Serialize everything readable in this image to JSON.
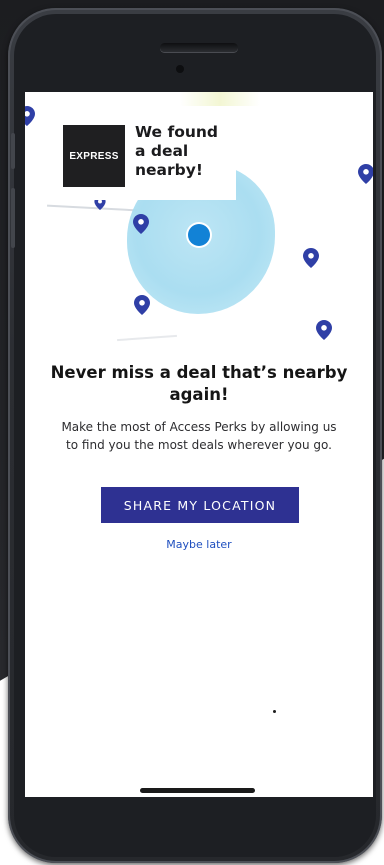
{
  "callout": {
    "brand": "EXPRESS",
    "message_lines": [
      "We found",
      "a deal",
      "nearby!"
    ]
  },
  "headline_lines": [
    "Never miss a deal that’s nearby",
    "again!"
  ],
  "subtext_lines": [
    "Make the most of Access Perks by allowing us",
    "to find you the most deals wherever you go."
  ],
  "actions": {
    "share_location_label": "SHARE MY LOCATION",
    "maybe_later_label": "Maybe later"
  },
  "map": {
    "pin_icon": "map-pin-icon",
    "user_marker_icon": "current-location-dot-icon"
  },
  "colors": {
    "primary_button": "#2e3192",
    "link": "#1f4fbf",
    "pin": "#2f3fa6",
    "location_dot": "#1282d6",
    "radius_fill": "#a6dcf0",
    "brand_box": "#1f1f21"
  }
}
